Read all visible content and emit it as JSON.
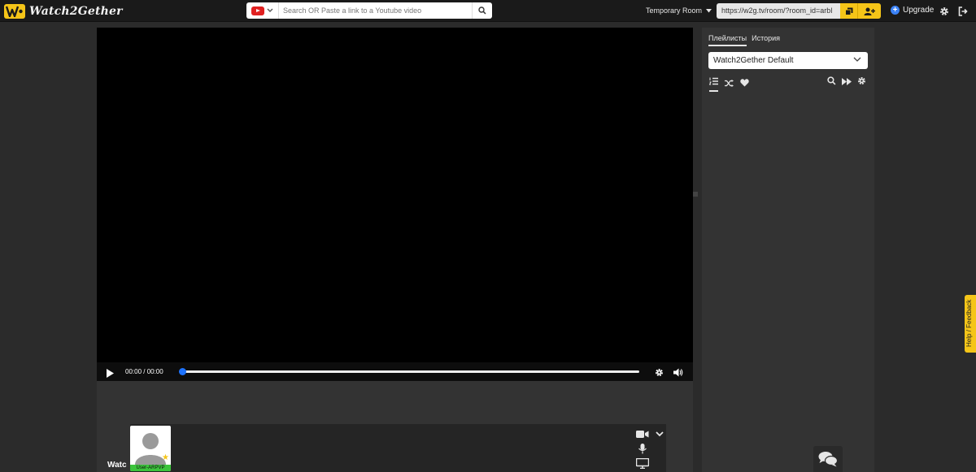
{
  "header": {
    "logo_text": "Watch2Gether",
    "search_placeholder": "Search OR Paste a link to a Youtube video",
    "provider_icon": "youtube-icon",
    "room_label": "Temporary Room",
    "room_url": "https://w2g.tv/room/?room_id=arbl",
    "upgrade_label": "Upgrade",
    "accent_color": "#f5c518"
  },
  "player": {
    "time": "00:00 / 00:00",
    "progress": 0
  },
  "users": {
    "label": "Watc",
    "user_name": "User-ARPVP"
  },
  "sidebar": {
    "tabs": [
      {
        "label": "Плейлисты",
        "active": true
      },
      {
        "label": "История",
        "active": false
      }
    ],
    "playlist_selected": "Watch2Gether Default"
  },
  "feedback": {
    "label": "Help / Feedback"
  }
}
